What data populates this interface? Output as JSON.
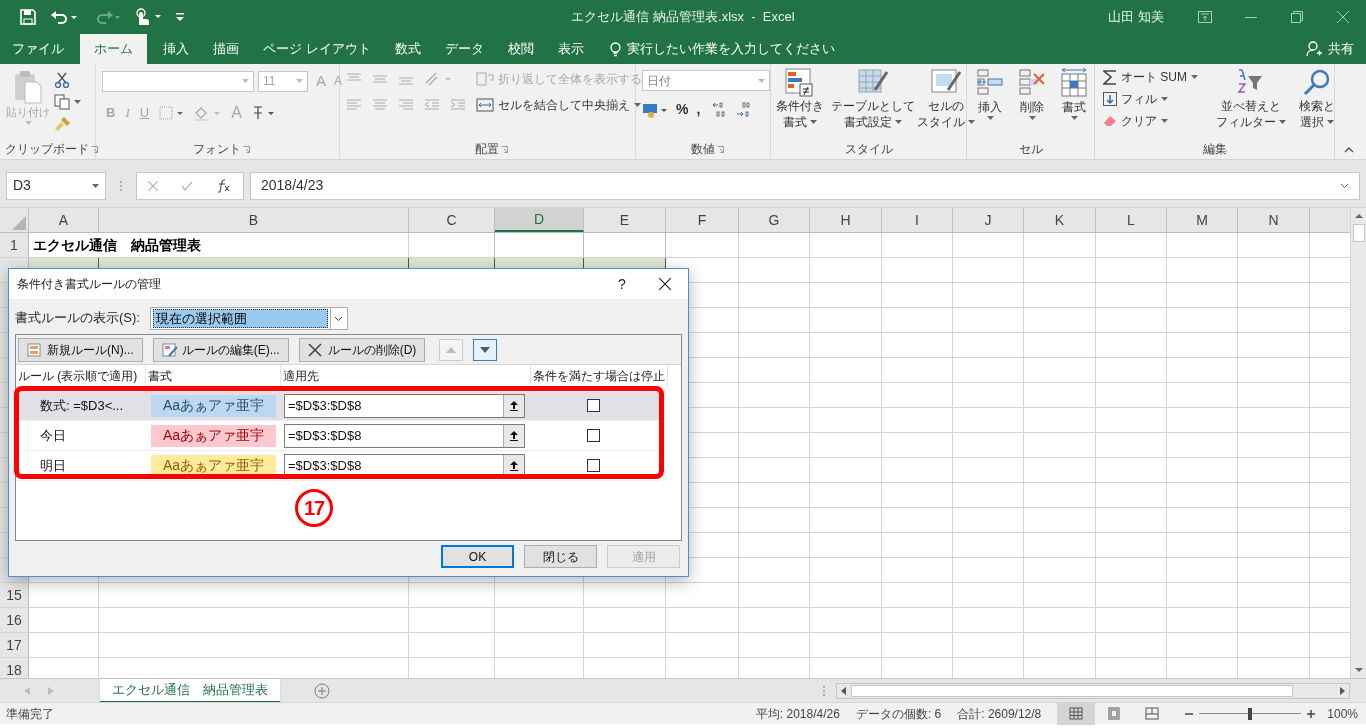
{
  "title_bar": {
    "title": "エクセル通信 納品管理表.xlsx  -  Excel",
    "user": "山田 知美"
  },
  "menu_tabs": [
    {
      "label": "ファイル",
      "selected": false
    },
    {
      "label": "ホーム",
      "selected": true
    },
    {
      "label": "挿入",
      "selected": false
    },
    {
      "label": "描画",
      "selected": false
    },
    {
      "label": "ページ レイアウト",
      "selected": false
    },
    {
      "label": "数式",
      "selected": false
    },
    {
      "label": "データ",
      "selected": false
    },
    {
      "label": "校閲",
      "selected": false
    },
    {
      "label": "表示",
      "selected": false
    }
  ],
  "tell_me": "実行したい作業を入力してください",
  "share": "共有",
  "ribbon": {
    "clipboard": {
      "label": "クリップボード",
      "paste": "貼り付け",
      "disabled": true
    },
    "font": {
      "label": "フォント",
      "disabled": true,
      "size": "11",
      "grow": "A",
      "shrink": "A",
      "bold": "B",
      "italic": "I",
      "underline": "U",
      "font_color": "A"
    },
    "alignment": {
      "label": "配置",
      "items": [
        {
          "label": "折り返して全体を表示する",
          "disabled": true
        },
        {
          "label": "セルを結合して中央揃え",
          "disabled": false
        }
      ]
    },
    "number": {
      "label": "数値",
      "format": "日付",
      "percent": "%",
      "comma": ","
    },
    "styles": {
      "label": "スタイル",
      "buttons": [
        {
          "lines": [
            "条件付き",
            "書式"
          ]
        },
        {
          "lines": [
            "テーブルとして",
            "書式設定"
          ]
        },
        {
          "lines": [
            "セルの",
            "スタイル"
          ]
        }
      ]
    },
    "cells": {
      "label": "セル",
      "buttons": [
        "挿入",
        "削除",
        "書式"
      ]
    },
    "editing": {
      "label": "編集",
      "autosum": "オート SUM",
      "fill": "フィル",
      "clear": "クリア",
      "buttons": [
        {
          "lines": [
            "並べ替えと",
            "フィルター"
          ]
        },
        {
          "lines": [
            "検索と",
            "選択"
          ]
        }
      ]
    }
  },
  "formula_bar": {
    "name_box": "D3",
    "value": "2018/4/23"
  },
  "sheet": {
    "columns": [
      {
        "label": "A",
        "selected": false
      },
      {
        "label": "B",
        "selected": false
      },
      {
        "label": "C",
        "selected": false
      },
      {
        "label": "D",
        "selected": true
      },
      {
        "label": "E",
        "selected": false
      },
      {
        "label": "F",
        "selected": false
      },
      {
        "label": "G",
        "selected": false
      },
      {
        "label": "H",
        "selected": false
      },
      {
        "label": "I",
        "selected": false
      },
      {
        "label": "J",
        "selected": false
      },
      {
        "label": "K",
        "selected": false
      },
      {
        "label": "L",
        "selected": false
      },
      {
        "label": "M",
        "selected": false
      },
      {
        "label": "N",
        "selected": false
      }
    ],
    "title_row": {
      "number": "1",
      "text": "エクセル通信　納品管理表"
    },
    "bottom_rows": [
      "15",
      "16",
      "17",
      "18"
    ],
    "tabs": [
      {
        "label": "エクセル通信　納品管理表",
        "selected": true
      }
    ]
  },
  "dialog": {
    "title": "条件付き書式ルールの管理",
    "help": "?",
    "show_label": "書式ルールの表示(S):",
    "show_value": "現在の選択範囲",
    "toolbar": [
      {
        "kind": "new",
        "label": "新規ルール(N)..."
      },
      {
        "kind": "edit",
        "label": "ルールの編集(E)..."
      },
      {
        "kind": "delete",
        "label": "ルールの削除(D)"
      },
      {
        "kind": "up",
        "disabled": true
      },
      {
        "kind": "down",
        "disabled": false
      }
    ],
    "columns": [
      "ルール (表示順で適用)",
      "書式",
      "適用先",
      "条件を満たす場合は停止"
    ],
    "rules": [
      {
        "rule": "数式: =$D3<...",
        "preview": "Aaあぁアァ亜宇",
        "kind": "blue",
        "color": "#bdd7ee",
        "applies_to": "=$D$3:$D$8",
        "stop": false,
        "selected": true
      },
      {
        "rule": "今日",
        "preview": "Aaあぁアァ亜宇",
        "kind": "red",
        "color": "#ffc7ce",
        "applies_to": "=$D$3:$D$8",
        "stop": false,
        "selected": false
      },
      {
        "rule": "明日",
        "preview": "Aaあぁアァ亜宇",
        "kind": "yellow",
        "color": "#ffeb9c",
        "applies_to": "=$D$3:$D$8",
        "stop": false,
        "selected": false
      }
    ],
    "buttons": [
      {
        "label": "OK",
        "default": true,
        "disabled": false
      },
      {
        "label": "閉じる",
        "default": false,
        "disabled": false
      },
      {
        "label": "適用",
        "default": false,
        "disabled": true
      }
    ],
    "step_number": "17"
  },
  "status_bar": {
    "mode": "準備完了",
    "stats": [
      "平均: 2018/4/26",
      "データの個数: 6",
      "合計: 2609/12/8"
    ],
    "views": [
      {
        "kind": "normal",
        "selected": true
      },
      {
        "kind": "layout",
        "selected": false
      },
      {
        "kind": "pagebreak",
        "selected": false
      }
    ],
    "zoom": "100%",
    "zoom_slider": {
      "level": 0.5
    }
  }
}
